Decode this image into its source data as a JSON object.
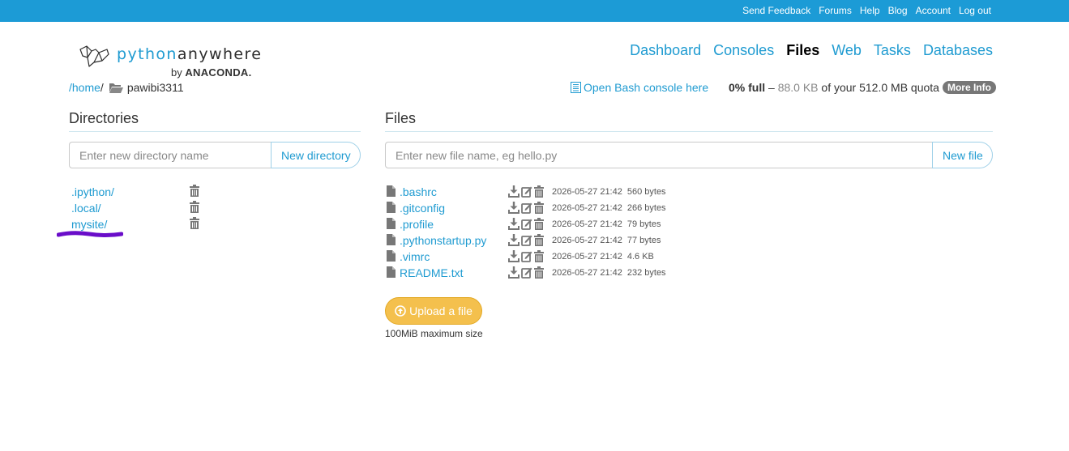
{
  "topbar": {
    "links": [
      "Send Feedback",
      "Forums",
      "Help",
      "Blog",
      "Account",
      "Log out"
    ]
  },
  "logo": {
    "python": "python",
    "anywhere": "anywhere",
    "by": "by",
    "anaconda": "ANACONDA."
  },
  "nav": {
    "items": [
      "Dashboard",
      "Consoles",
      "Files",
      "Web",
      "Tasks",
      "Databases"
    ],
    "active": "Files"
  },
  "breadcrumb": {
    "home": "/home",
    "sep": "/",
    "current": "pawibi3311"
  },
  "bash": {
    "label": "Open Bash console here"
  },
  "quota": {
    "percent": "0% full",
    "dash": " – ",
    "used": "88.0 KB",
    "rest": " of your 512.0 MB quota",
    "more_info": "More Info"
  },
  "directories": {
    "title": "Directories",
    "placeholder": "Enter new directory name",
    "button": "New directory",
    "items": [
      ".ipython/",
      ".local/",
      "mysite/"
    ]
  },
  "files": {
    "title": "Files",
    "placeholder": "Enter new file name, eg hello.py",
    "button": "New file",
    "items": [
      {
        "name": ".bashrc",
        "date": "2026-05-27 21:42",
        "size": "560 bytes"
      },
      {
        "name": ".gitconfig",
        "date": "2026-05-27 21:42",
        "size": "266 bytes"
      },
      {
        "name": ".profile",
        "date": "2026-05-27 21:42",
        "size": "79 bytes"
      },
      {
        "name": ".pythonstartup.py",
        "date": "2026-05-27 21:42",
        "size": "77 bytes"
      },
      {
        "name": ".vimrc",
        "date": "2026-05-27 21:42",
        "size": "4.6 KB"
      },
      {
        "name": "README.txt",
        "date": "2026-05-27 21:42",
        "size": "232 bytes"
      }
    ]
  },
  "upload": {
    "label": "Upload a file",
    "note": "100MiB maximum size"
  },
  "colors": {
    "topbar": "#1c9bd6",
    "link": "#1f9bd1",
    "upload": "#f4c04d",
    "scribble": "#6a0dc9"
  }
}
